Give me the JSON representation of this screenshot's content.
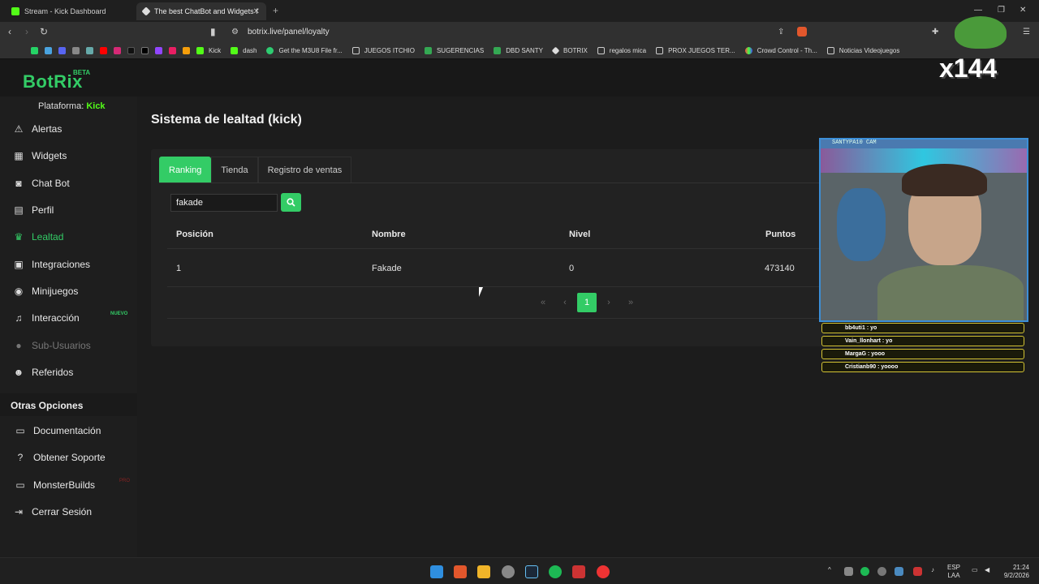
{
  "browser": {
    "tabs": [
      {
        "title": "Stream - Kick Dashboard"
      },
      {
        "title": "The best ChatBot and Widgets f"
      }
    ],
    "url": "botrix.live/panel/loyalty",
    "bookmarks": [
      "Kick",
      "dash",
      "Get the M3U8 File fr...",
      "JUEGOS ITCHIO",
      "SUGERENCIAS",
      "DBD SANTY",
      "BOTRIX",
      "regalos mica",
      "PROX JUEGOS TER...",
      "Crowd Control - Th...",
      "Noticias Videojuegos"
    ]
  },
  "app": {
    "logo": "BotRix",
    "beta": "BETA",
    "platform_label": "Plataforma:",
    "platform_value": "Kick",
    "sidebar": [
      {
        "label": "Alertas",
        "icon": "bell-icon"
      },
      {
        "label": "Widgets",
        "icon": "grid-icon"
      },
      {
        "label": "Chat Bot",
        "icon": "robot-icon"
      },
      {
        "label": "Perfil",
        "icon": "id-card-icon"
      },
      {
        "label": "Lealtad",
        "icon": "trophy-icon"
      },
      {
        "label": "Integraciones",
        "icon": "list-icon"
      },
      {
        "label": "Minijuegos",
        "icon": "gamepad-icon"
      },
      {
        "label": "Interacción",
        "icon": "music-icon"
      },
      {
        "label": "Sub-Usuarios",
        "icon": "users-icon"
      },
      {
        "label": "Referidos",
        "icon": "user-plus-icon"
      }
    ],
    "nuevo_badge": "NUEVO",
    "other_options_title": "Otras Opciones",
    "other_options": [
      {
        "label": "Documentación",
        "icon": "book-icon"
      },
      {
        "label": "Obtener Soporte",
        "icon": "question-icon"
      },
      {
        "label": "MonsterBuilds",
        "icon": "monitor-icon"
      },
      {
        "label": "Cerrar Sesión",
        "icon": "logout-icon"
      }
    ],
    "pro_badge": "PRO"
  },
  "main": {
    "title": "Sistema de lealtad (kick)",
    "tabs": [
      "Ranking",
      "Tienda",
      "Registro de ventas"
    ],
    "search_value": "fakade",
    "columns": [
      "Posición",
      "Nombre",
      "Nivel",
      "Puntos"
    ],
    "rows": [
      {
        "position": "1",
        "name": "Fakade",
        "level": "0",
        "points": "473140"
      }
    ],
    "pagination": {
      "first": "«",
      "prev": "‹",
      "current": "1",
      "next": "›",
      "last": "»"
    }
  },
  "overlay": {
    "cam_title": "SANTYPA10 CAM",
    "counter": "x144",
    "chat": [
      "bb4uti1 : yo",
      "Vain_llonhart : yo",
      "MargaG : yooo",
      "Cristianb90 : yoooo"
    ]
  },
  "taskbar": {
    "lang": "ESP",
    "lang2": "LAA",
    "time": "21:24",
    "date": "9/2/2026"
  },
  "colors": {
    "accent": "#33cc66",
    "kick_green": "#53fc18"
  }
}
